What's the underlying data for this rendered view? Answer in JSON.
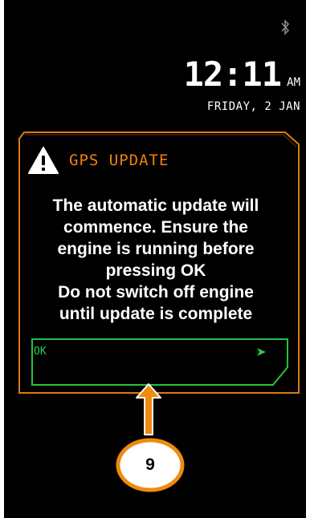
{
  "status": {
    "time": "12:11",
    "meridiem": "AM",
    "date": "FRIDAY, 2 JAN",
    "bluetooth_icon": "bluetooth-icon"
  },
  "dialog": {
    "title": "GPS UPDATE",
    "title_icon": "warning-triangle-icon",
    "message_lines": [
      "The automatic update will",
      "commence. Ensure the",
      "engine is running before",
      "pressing OK",
      "Do not switch off engine",
      "until update is complete"
    ],
    "ok_label": "OK",
    "ok_icon": "chevron-right-icon"
  },
  "callout": {
    "number": "9"
  },
  "colors": {
    "accent_orange": "#f0820a",
    "ok_green": "#28d04a",
    "background": "#000000"
  }
}
